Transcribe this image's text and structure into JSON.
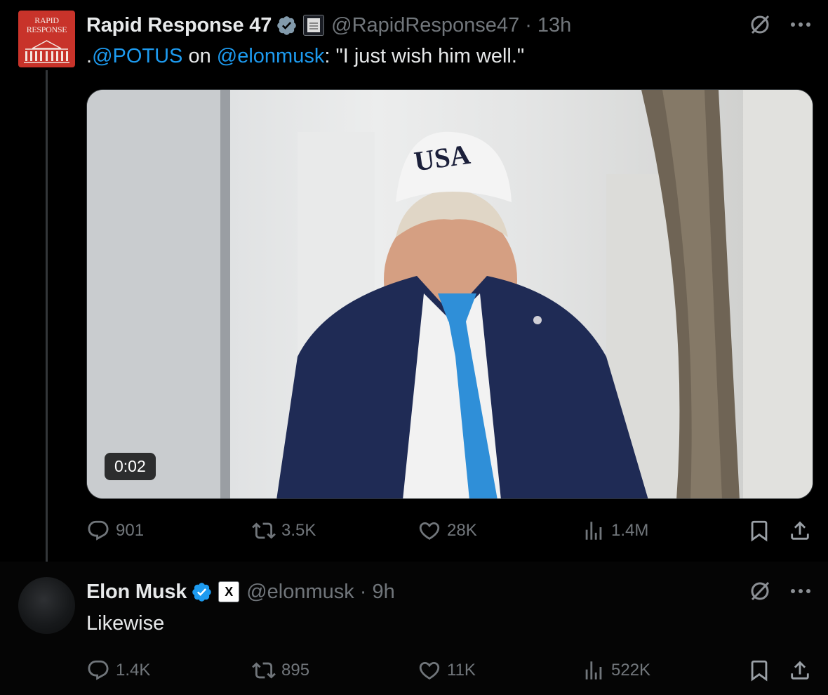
{
  "tweets": [
    {
      "avatar_text": "RAPID RESPONSE",
      "author_name": "Rapid Response 47",
      "handle": "@RapidResponse47",
      "time": "· 13h",
      "text_prefix": ".",
      "mention1": "@POTUS",
      "text_mid": " on ",
      "mention2": "@elonmusk",
      "text_suffix": ": \"I just wish him well.\"",
      "media": {
        "type": "video",
        "duration": "0:02",
        "hat_text": "USA"
      },
      "stats": {
        "replies": "901",
        "reposts": "3.5K",
        "likes": "28K",
        "views": "1.4M"
      }
    },
    {
      "author_name": "Elon Musk",
      "handle": "@elonmusk",
      "time": "· 9h",
      "affiliate_badge": "X",
      "text": "Likewise",
      "stats": {
        "replies": "1.4K",
        "reposts": "895",
        "likes": "11K",
        "views": "522K"
      }
    }
  ],
  "colors": {
    "background": "#000000",
    "text_primary": "#e7e9ea",
    "text_secondary": "#71767b",
    "accent": "#1d9bf0",
    "verified": "#1d9bf0"
  },
  "icons": [
    "verified-icon",
    "grok-icon",
    "more-icon",
    "reply-icon",
    "repost-icon",
    "like-icon",
    "views-icon",
    "bookmark-icon",
    "share-icon"
  ]
}
